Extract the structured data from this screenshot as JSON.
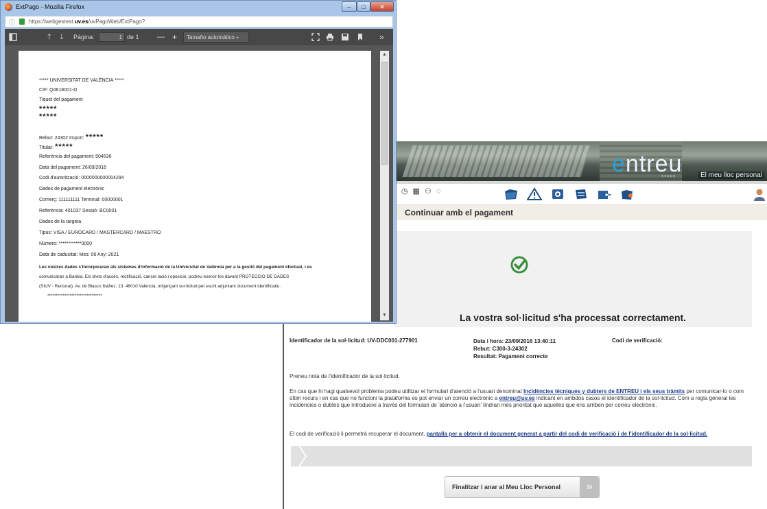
{
  "firefox": {
    "window_title": "ExtPago - Mozilla Firefox",
    "url_prefix": "https://webgestest.",
    "url_domain": "uv.es",
    "url_path": "/uvPagoWeb/ExtPago?",
    "window_buttons": {
      "minimize": "–",
      "maximize": "□",
      "close": "✕"
    }
  },
  "pdf_toolbar": {
    "page_label": "Página:",
    "page_value": "1",
    "page_total": "de 1",
    "zoom_minus": "—",
    "zoom_plus": "+",
    "zoom_value": "Tamaño automático  ÷",
    "more": "»"
  },
  "ticket": {
    "university": "***** UNIVERSITAT DE VALÈNCIA *****",
    "cif": "CIF:  Q4618001-D",
    "ticket_title": "Tiquet del pagament",
    "masked_line_1": "*****",
    "masked_line_2": "*****",
    "rebut_label": "Rebut: 24302  Import:",
    "rebut_masked": "*****",
    "titular_label": "Titular:",
    "titular_masked": "*****",
    "referencia_pagament": "Referència del pagament: 504536",
    "data_pagament": "Data del pagament: 26/09/2016",
    "codi_autoritzacio": "Codi d'autorització: 0000000000004294",
    "dades_pagament": "Dades de pagament electrònic",
    "comerc": "Comerç: 111111111      Terminal: 00000001",
    "referencia_sessio": "Referència: 401037  Sessió: BC0001",
    "dades_targeta": "Dades de la targeta",
    "tipus": "Tipus: VISA / EUROCARD / MASTERCARD / MAESTRO",
    "numero": "Número: ************0000",
    "caducitat": "Data de caducitat: Mes: 06  Any: 2021",
    "legal_1": "Les vostres dades s'incorporaran als sistemes d'informació de la Universitat de València per a la gestió del pagament efectuat, i es",
    "legal_2": "comunicaran a Bankia. Els drets d'accés, rectificació, cancel·lació i oposició, podreu exercir-los davant PROTECCIÓ DE DADES",
    "legal_3": "(SIUV - Rectorat), Av. de Blasco Ibáñez, 13. 46010 València, mitjançant sol·licitud per escrit adjuntant document identificatiu.",
    "legal_stars": "********************************"
  },
  "entreu": {
    "logo_e": "e",
    "logo_rest": "ntreu",
    "logo_stars": "*****",
    "tagline": "El meu lloc personal",
    "subtitle": "Continuar amb el pagament",
    "success_title": "La vostra sol·licitud s'ha processat correctament.",
    "identificador": "Identificador de la sol·licitud: UV-DDC001-277901",
    "data_hora": "Data i hora: 23/09/2016 13:40:11",
    "rebut": "Rebut: C300-3-24302",
    "resultat": "Resultat: Pagament correcte",
    "codi_verificacio": "Codi de verificació:",
    "note": "Preneu nota de l'identificador de la sol·licitud.",
    "para2_a": "En cas que hi hagi qualsevol problema podeu utilitzar el formulari d'atenció a l'usuari denominat ",
    "para2_link1": "Incidències tècniques y dubters de ENTREU i els seus tràmits",
    "para2_b": " per comunicar-lo o com últim recurs i en cas que no funcioni la plataforma es pot enviar un correu electrònic a ",
    "para2_link2": "entreu@uv.es",
    "para2_c": " indicant en ambdós casos el identificador de la sol·licitud. Com a regla general les incidències o dubtes que introdueixi a través del formulari de 'atenció a l'usuari' tindran més prioritat que aquelles que ens arriben per correu electrònic.",
    "para3_a": "El codi de verificació li permetrà recuperar el document. ",
    "para3_link": "pantalla per a obtenir el document generat a partir del codi de verificació i de l'identificador de la sol·licitud.",
    "finish_button": "Finalitzar i anar al Meu Lloc Personal",
    "finish_arrow": "»"
  },
  "colors": {
    "firefox_frame": "#a9c6e8",
    "pdf_toolbar": "#474747",
    "pdf_viewer_bg": "#575757",
    "success_green": "#3a8f3a",
    "link_blue": "#1d3d8a",
    "logo_blue": "#2a9fd6"
  }
}
